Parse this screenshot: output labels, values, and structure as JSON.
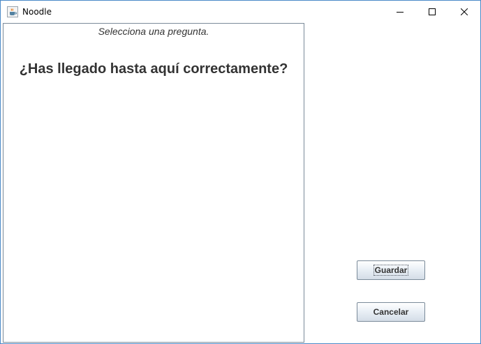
{
  "window": {
    "title": "Noodle",
    "icons": {
      "app": "java-cup-icon",
      "minimize": "minimize-icon",
      "maximize": "maximize-icon",
      "close": "close-icon"
    }
  },
  "question_panel": {
    "hint": "Selecciona una pregunta.",
    "question": "¿Has llegado hasta aquí correctamente?"
  },
  "actions": {
    "save_label": "Guardar",
    "cancel_label": "Cancelar"
  },
  "colors": {
    "window_border": "#4a89c8",
    "panel_border": "#7a8a99",
    "text": "#333333",
    "button_top": "#ffffff",
    "button_bottom": "#d4dde7"
  }
}
